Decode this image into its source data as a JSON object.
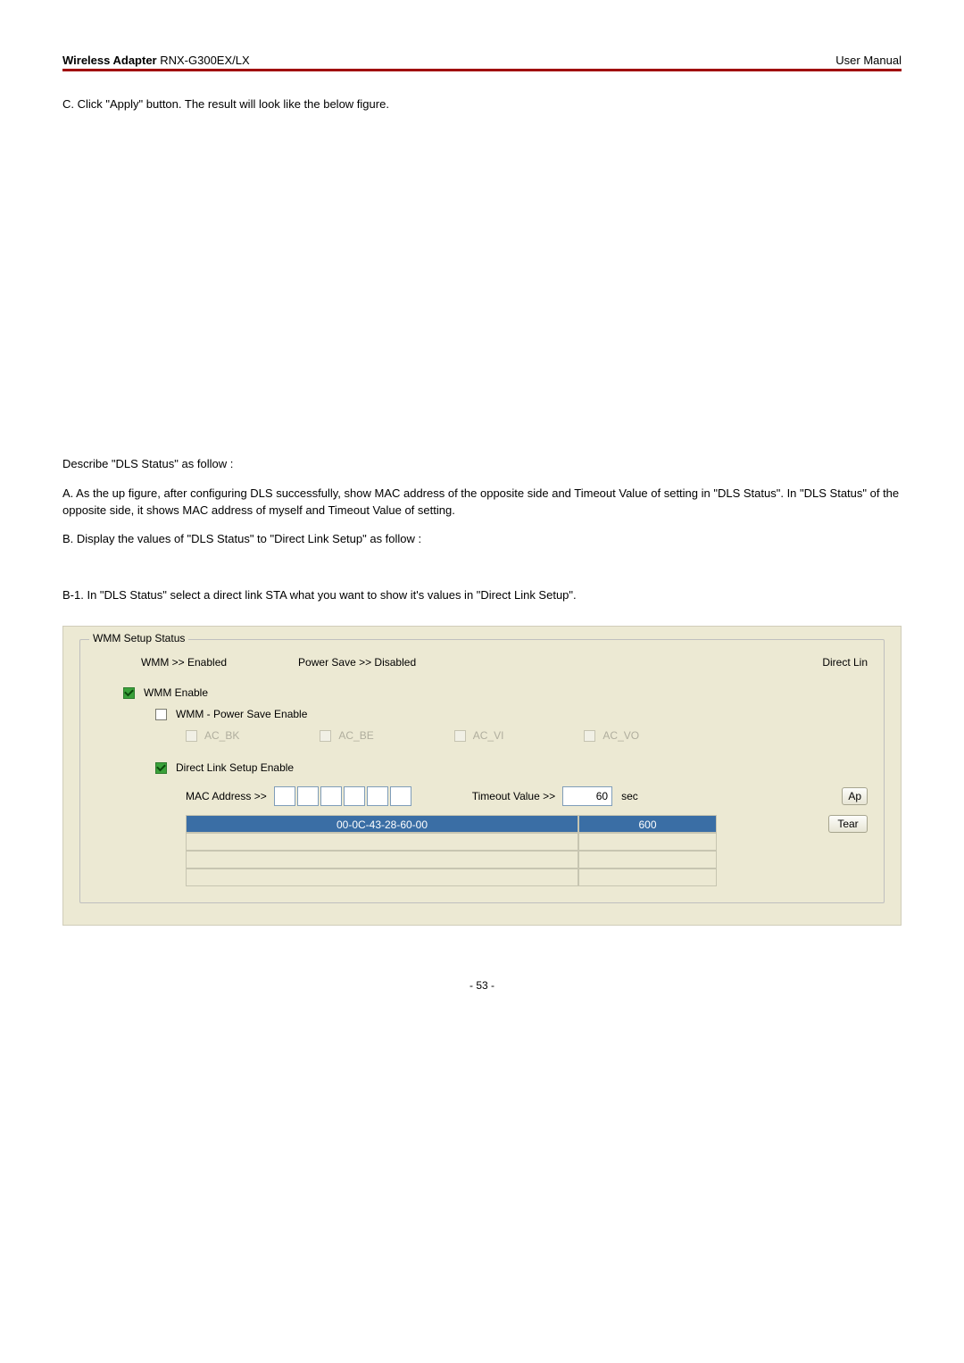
{
  "header": {
    "product_bold": "Wireless Adapter",
    "product_model": " RNX-G300EX/LX",
    "right": "User Manual"
  },
  "body": {
    "step_c": "C. Click \"Apply\" button. The result will look like the below figure.",
    "describe": "Describe \"DLS Status\" as follow :",
    "a": "A. As the up figure, after configuring DLS successfully, show MAC address of the opposite side and Timeout Value of setting in \"DLS Status\". In \"DLS Status\" of the opposite side, it shows MAC address of myself and Timeout Value of setting.",
    "b": "B. Display the values of \"DLS Status\" to \"Direct Link Setup\" as follow :",
    "b1": "B-1.   In \"DLS Status\" select a direct link STA what you want to show it's values in \"Direct Link Setup\"."
  },
  "panel": {
    "group_title": "WMM Setup Status",
    "status_wmm": "WMM >> Enabled",
    "status_ps": "Power Save >> Disabled",
    "status_dl": "Direct Lin",
    "wmm_enable": "WMM Enable",
    "ps_enable": "WMM - Power Save Enable",
    "ac_bk": "AC_BK",
    "ac_be": "AC_BE",
    "ac_vi": "AC_VI",
    "ac_vo": "AC_VO",
    "dls_enable": "Direct Link Setup Enable",
    "mac_label": "MAC Address >>",
    "timeout_label": "Timeout Value >>",
    "timeout_value": "60",
    "sec": "sec",
    "btn_apply": "Ap",
    "btn_tear": "Tear",
    "table_mac": "00-0C-43-28-60-00",
    "table_timeout": "600"
  },
  "page_number": "- 53 -"
}
